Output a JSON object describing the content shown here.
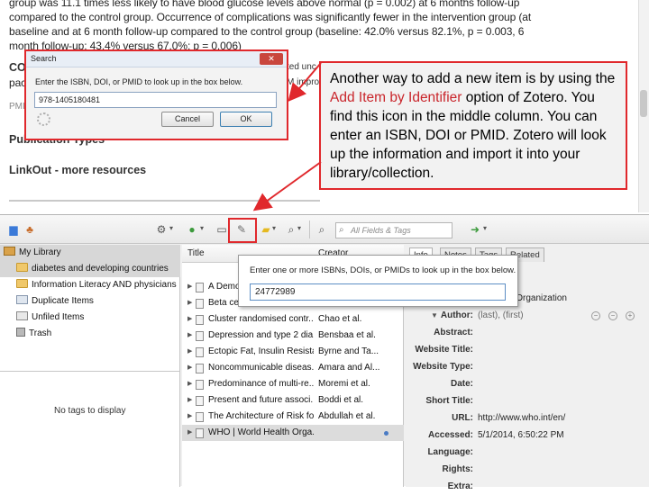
{
  "article": {
    "lines": [
      "group was 11.1 times less likely to have blood glucose levels above normal (p = 0.002) at 6 months follow-up",
      "compared to the control group. Occurrence of complications was significantly fewer in the intervention group (at",
      "baseline and at 6 month follow-up compared to the control group (baseline: 42.0% versus 82.1%, p = 0.003, 6",
      "month follow-up: 43.4% versus 67.0%; p = 0.006)"
    ],
    "frag_co": "CO",
    "frag_pac": "pac",
    "frag_pmi": "PMI",
    "frag_right1": "ted unc",
    "frag_right2": "M improv",
    "publication_types": "Publication Types",
    "linkout": "LinkOut - more resources"
  },
  "search_dialog": {
    "title": "Search",
    "close": "✕",
    "prompt": "Enter the ISBN, DOI, or PMID to look up in the box below.",
    "value": "978-1405180481",
    "cancel": "Cancel",
    "ok": "OK"
  },
  "callout": {
    "before": "Another way to add a new item is by using the ",
    "highlight": "Add Item by Identifier",
    "after": " option of Zotero. You find this icon in the middle column. You can enter an ISBN, DOI or PMID. Zotero will look up the information and import it into your library/collection.",
    "highlight_color": "#c9252b"
  },
  "zotero": {
    "search_placeholder": "All Fields & Tags",
    "collections": [
      {
        "label": "My Library",
        "icon": "library-icon"
      },
      {
        "label": "diabetes and developing countries",
        "icon": "folder-icon"
      },
      {
        "label": "Information Literacy AND physicians",
        "icon": "folder-icon"
      },
      {
        "label": "Duplicate Items",
        "icon": "duplicate-icon"
      },
      {
        "label": "Unfiled Items",
        "icon": "unfiled-icon"
      },
      {
        "label": "Trash",
        "icon": "trash-icon"
      }
    ],
    "tags_empty": "No tags to display",
    "columns": {
      "title": "Title",
      "creator": "Creator"
    },
    "items": [
      {
        "title": "A Demo",
        "creator": ""
      },
      {
        "title": "Beta ce",
        "creator": ""
      },
      {
        "title": "Cluster randomised contr...",
        "creator": "Chao et al."
      },
      {
        "title": "Depression and type 2 dia...",
        "creator": "Bensbaa et al."
      },
      {
        "title": "Ectopic Fat, Insulin Resista...",
        "creator": "Byrne and Ta..."
      },
      {
        "title": "Noncommunicable diseas...",
        "creator": "Amara and Al..."
      },
      {
        "title": "Predominance of multi-re...",
        "creator": "Moremi et al."
      },
      {
        "title": "Present and future associ...",
        "creator": "Boddi et al."
      },
      {
        "title": "The Architecture of Risk fo...",
        "creator": "Abdullah et al."
      },
      {
        "title": "WHO | World Health Orga...",
        "creator": ""
      }
    ],
    "tabs": [
      "Info",
      "Notes",
      "Tags",
      "Related"
    ],
    "fields": [
      {
        "label": "",
        "value": "ld Health Organization"
      },
      {
        "label": "Author:",
        "value": "(last), (first)"
      },
      {
        "label": "Abstract:",
        "value": ""
      },
      {
        "label": "Website Title:",
        "value": ""
      },
      {
        "label": "Website Type:",
        "value": ""
      },
      {
        "label": "Date:",
        "value": ""
      },
      {
        "label": "Short Title:",
        "value": ""
      },
      {
        "label": "URL:",
        "value": "http://www.who.int/en/"
      },
      {
        "label": "Accessed:",
        "value": "5/1/2014, 6:50:22 PM"
      },
      {
        "label": "Language:",
        "value": ""
      },
      {
        "label": "Rights:",
        "value": ""
      },
      {
        "label": "Extra:",
        "value": ""
      }
    ],
    "identifier_popup": {
      "prompt": "Enter one or more ISBNs, DOIs, or PMIDs to look up in the box below.",
      "value": "24772989"
    }
  }
}
